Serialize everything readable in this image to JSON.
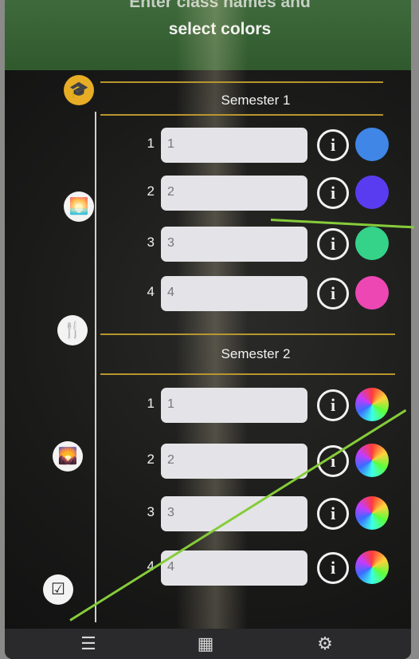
{
  "header": {
    "title_line1": "Enter class names and",
    "title_line2": "select colors"
  },
  "sidebar": {
    "items": [
      {
        "name": "graduation-cap-icon",
        "glyph": "🎓",
        "active": true
      },
      {
        "name": "sunrise-icon",
        "glyph": "🌅",
        "active": false
      },
      {
        "name": "fork-knife-icon",
        "glyph": "🍴",
        "active": false
      },
      {
        "name": "sunset-icon",
        "glyph": "🌄",
        "active": false
      },
      {
        "name": "checklist-icon",
        "glyph": "☑",
        "active": false
      }
    ]
  },
  "semesters": [
    {
      "label": "Semester 1",
      "classes": [
        {
          "number": "1",
          "value": "1",
          "color": "#3f86e6"
        },
        {
          "number": "2",
          "value": "2",
          "color": "#5a3cf0"
        },
        {
          "number": "3",
          "value": "3",
          "color": "#35d389"
        },
        {
          "number": "4",
          "value": "4",
          "color": "#ec47b3"
        }
      ]
    },
    {
      "label": "Semester 2",
      "classes": [
        {
          "number": "1",
          "value": "1",
          "color": "wheel"
        },
        {
          "number": "2",
          "value": "2",
          "color": "wheel"
        },
        {
          "number": "3",
          "value": "3",
          "color": "wheel"
        },
        {
          "number": "4",
          "value": "4",
          "color": "wheel"
        }
      ]
    }
  ],
  "info_glyph": "i",
  "bottom_tabs": [
    {
      "name": "menu-icon",
      "glyph": "☰"
    },
    {
      "name": "calendar-icon",
      "glyph": "▦"
    },
    {
      "name": "gear-icon",
      "glyph": "⚙"
    }
  ]
}
